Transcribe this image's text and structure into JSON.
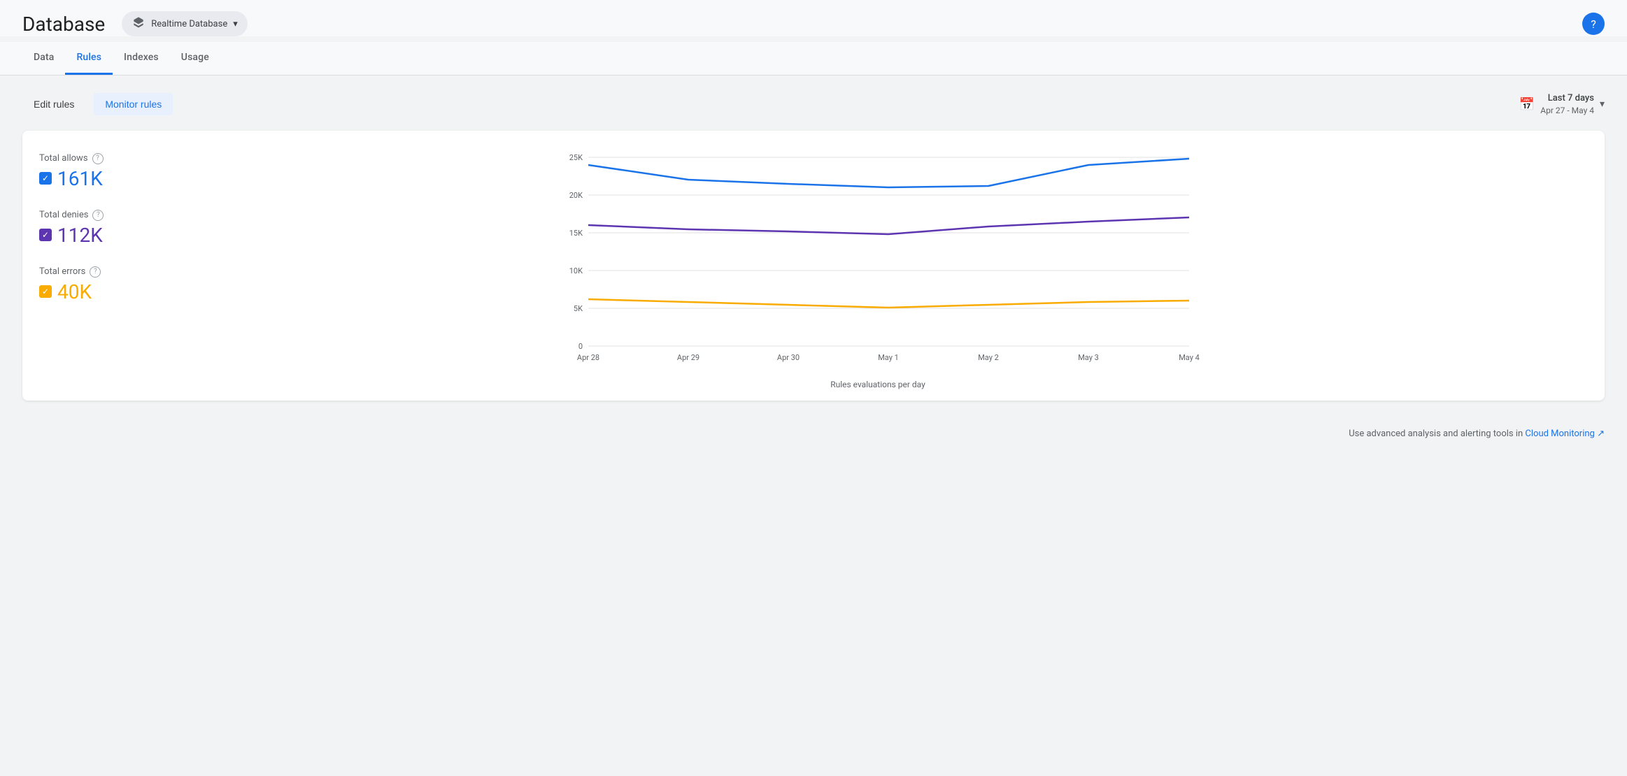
{
  "page": {
    "title": "Database",
    "db_selector": {
      "label": "Realtime Database",
      "icon": "database-icon"
    },
    "help_label": "?"
  },
  "nav": {
    "tabs": [
      {
        "id": "data",
        "label": "Data",
        "active": false
      },
      {
        "id": "rules",
        "label": "Rules",
        "active": true
      },
      {
        "id": "indexes",
        "label": "Indexes",
        "active": false
      },
      {
        "id": "usage",
        "label": "Usage",
        "active": false
      }
    ]
  },
  "toolbar": {
    "edit_rules_label": "Edit rules",
    "monitor_rules_label": "Monitor rules",
    "date_range": {
      "main": "Last 7 days",
      "sub": "Apr 27 - May 4"
    }
  },
  "chart": {
    "title": "Rules evaluations per day",
    "y_labels": [
      "25K",
      "20K",
      "15K",
      "10K",
      "5K",
      "0"
    ],
    "x_labels": [
      "Apr 28",
      "Apr 29",
      "Apr 30",
      "May 1",
      "May 2",
      "May 3",
      "May 4"
    ],
    "legend": [
      {
        "id": "allows",
        "label": "Total allows",
        "value": "161K",
        "color": "blue",
        "hex": "#1a73e8"
      },
      {
        "id": "denies",
        "label": "Total denies",
        "value": "112K",
        "color": "purple",
        "hex": "#5e35b1"
      },
      {
        "id": "errors",
        "label": "Total errors",
        "value": "40K",
        "color": "yellow",
        "hex": "#f9ab00"
      }
    ],
    "series": {
      "allows": [
        24000,
        22000,
        21500,
        21000,
        21200,
        24000,
        24500,
        24800
      ],
      "denies": [
        16000,
        15500,
        15200,
        15000,
        14800,
        15800,
        16500,
        17000
      ],
      "errors": [
        6200,
        5800,
        5500,
        5200,
        5100,
        5500,
        5800,
        6000
      ]
    }
  },
  "footer": {
    "text": "Use advanced analysis and alerting tools in",
    "link_label": "Cloud Monitoring",
    "link_icon": "external-link-icon"
  }
}
